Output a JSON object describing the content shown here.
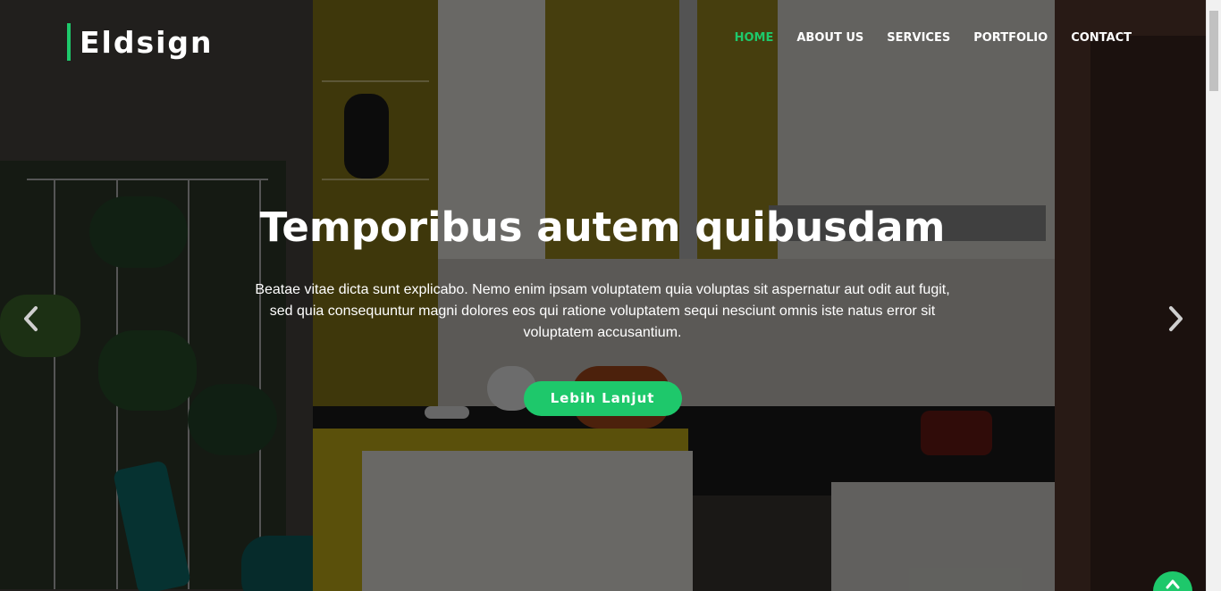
{
  "brand": {
    "name": "Eldsign",
    "accent_color": "#1ec86b"
  },
  "nav": {
    "items": [
      {
        "label": "HOME",
        "active": true
      },
      {
        "label": "ABOUT US",
        "active": false
      },
      {
        "label": "SERVICES",
        "active": false
      },
      {
        "label": "PORTFOLIO",
        "active": false
      },
      {
        "label": "CONTACT",
        "active": false
      }
    ]
  },
  "hero": {
    "title": "Temporibus autem quibusdam",
    "text": "Beatae vitae dicta sunt explicabo. Nemo enim ipsam voluptatem quia voluptas sit aspernatur aut odit aut fugit, sed quia consequuntur magni dolores eos qui ratione voluptatem sequi nesciunt omnis iste natus error sit voluptatem accusantium.",
    "button_label": "Lebih Lanjut"
  },
  "icons": {
    "prev": "chevron-left-icon",
    "next": "chevron-right-icon",
    "back_to_top": "chevron-up-icon"
  }
}
